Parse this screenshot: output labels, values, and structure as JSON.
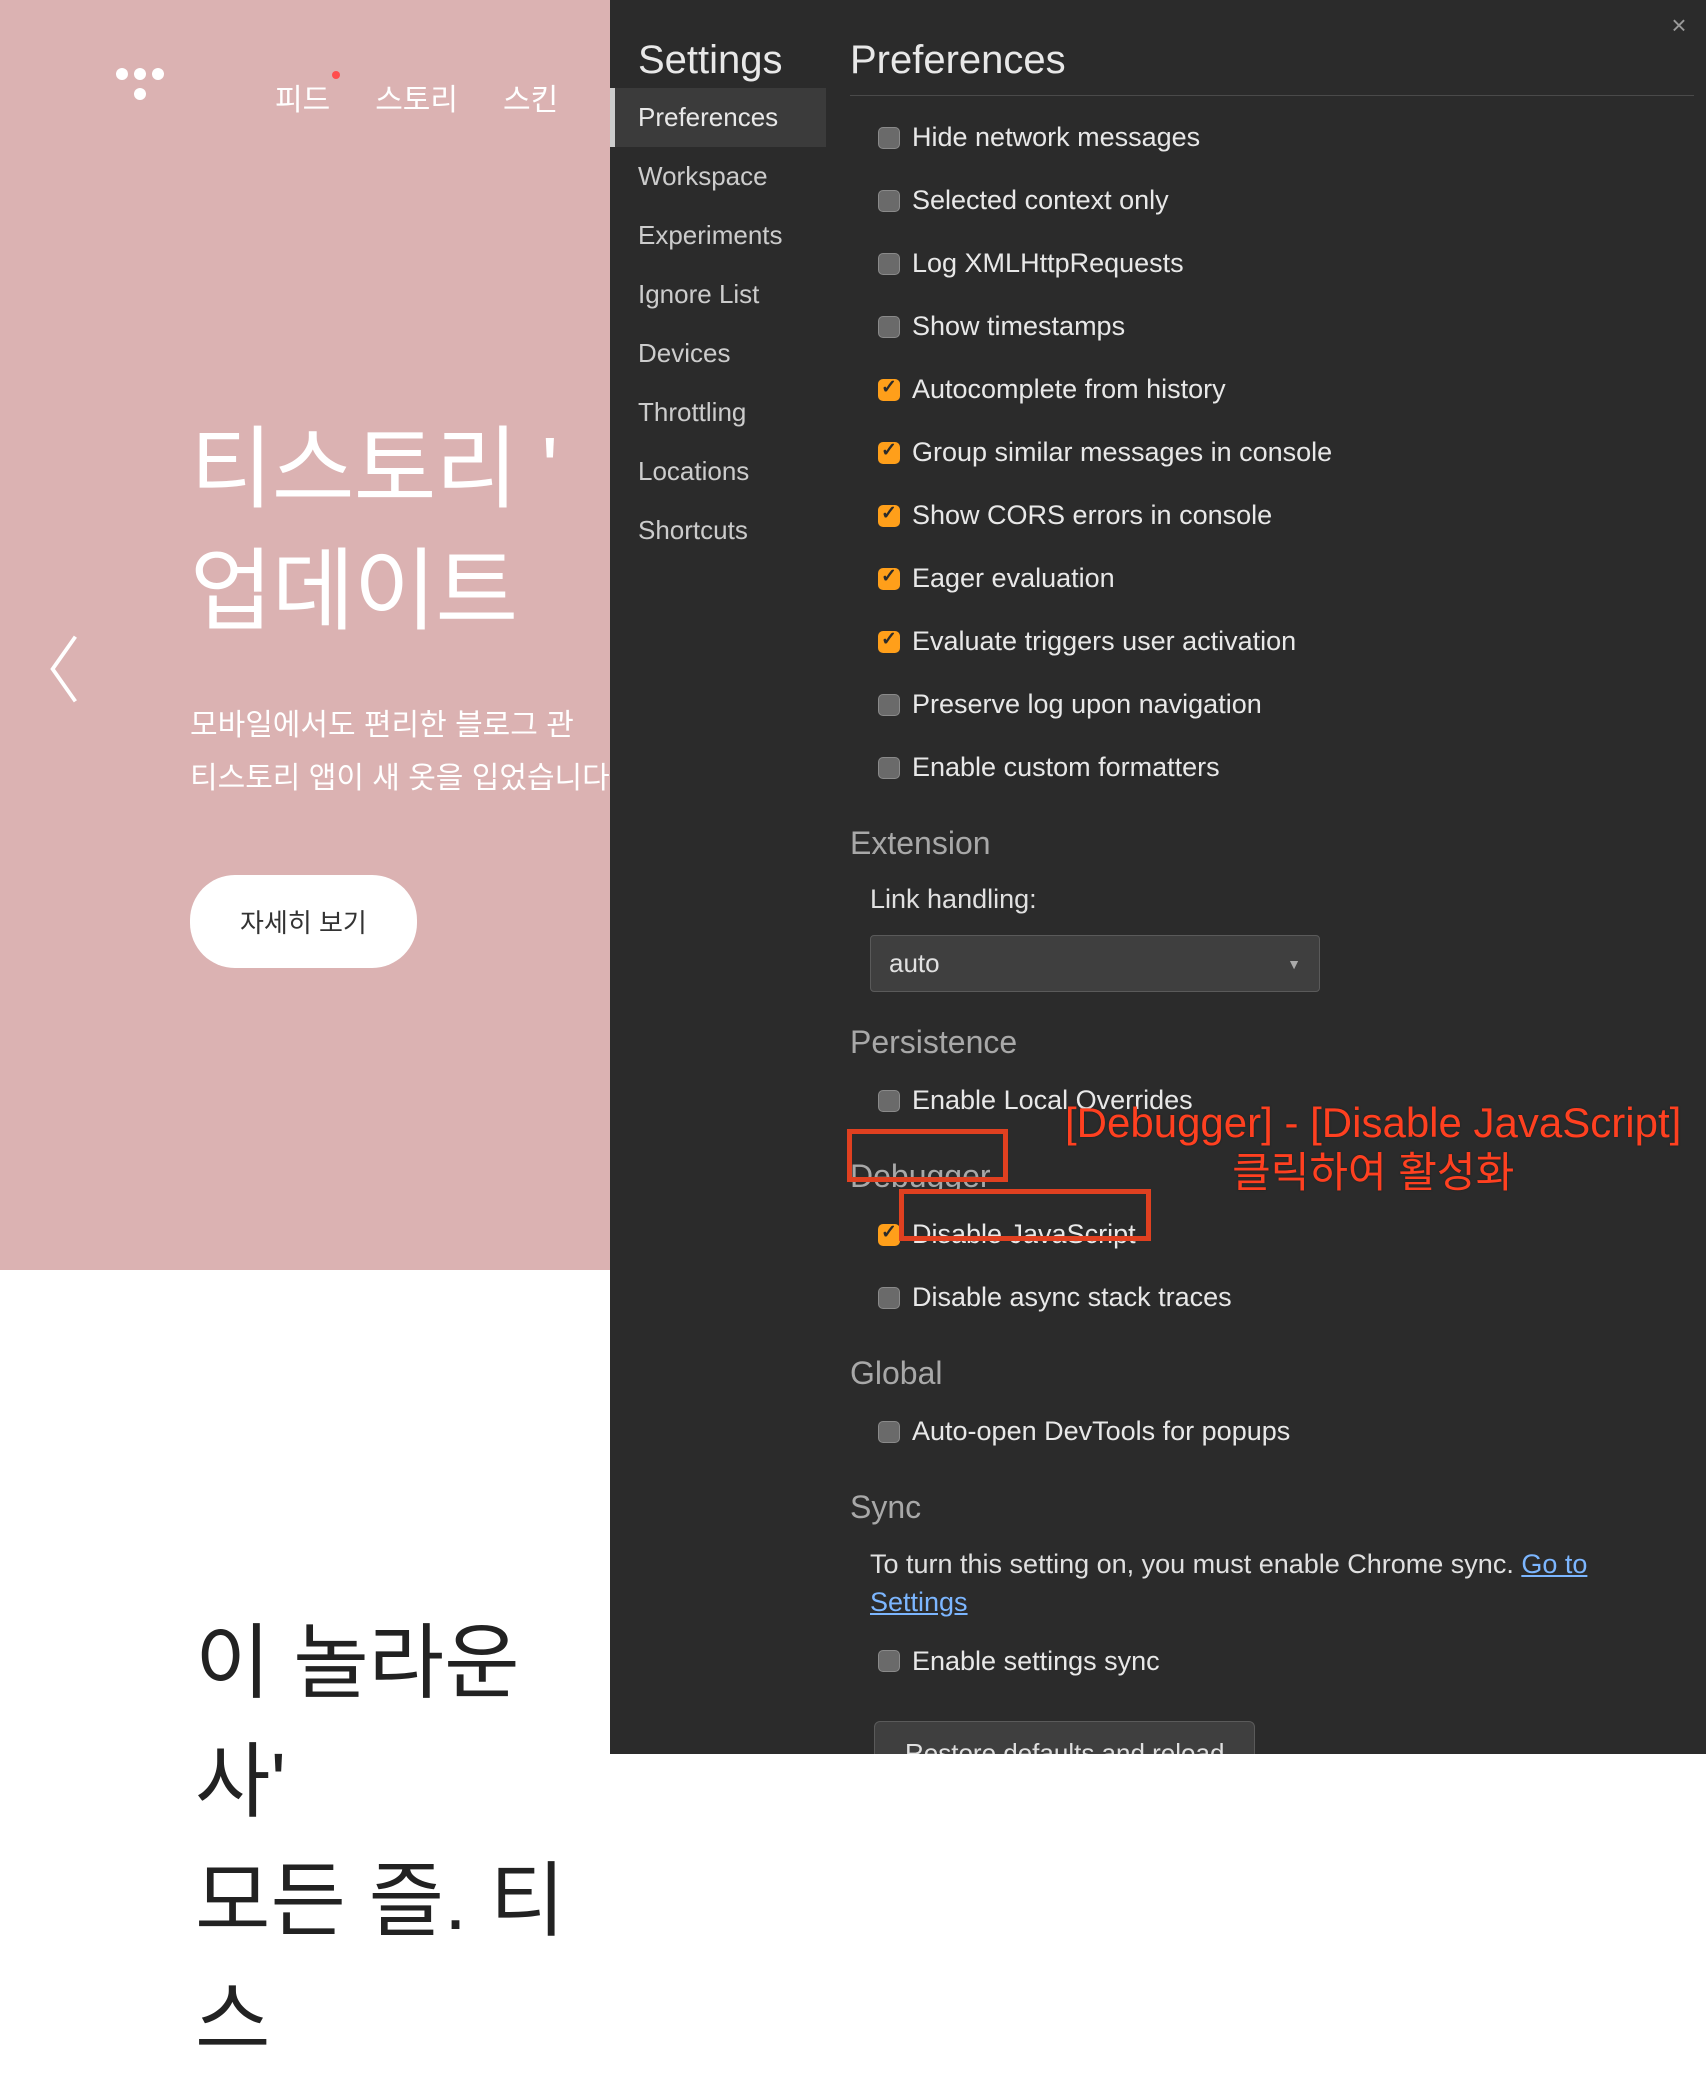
{
  "bg": {
    "nav": [
      "피드",
      "스토리",
      "스킨"
    ],
    "title_line1": "티스토리 '",
    "title_line2": "업데이트",
    "desc_line1": "모바일에서도 편리한 블로그 관",
    "desc_line2": "티스토리 앱이 새 옷을 입었습니다",
    "button": "자세히 보기",
    "bottom1": "이 놀라운 사'",
    "bottom2": "모든 즐. 티스"
  },
  "settings": {
    "title": "Settings",
    "close": "×",
    "sidebar": [
      "Preferences",
      "Workspace",
      "Experiments",
      "Ignore List",
      "Devices",
      "Throttling",
      "Locations",
      "Shortcuts"
    ],
    "preferences_title": "Preferences",
    "console": {
      "items": [
        {
          "label": "Hide network messages",
          "checked": false
        },
        {
          "label": "Selected context only",
          "checked": false
        },
        {
          "label": "Log XMLHttpRequests",
          "checked": false
        },
        {
          "label": "Show timestamps",
          "checked": false
        },
        {
          "label": "Autocomplete from history",
          "checked": true
        },
        {
          "label": "Group similar messages in console",
          "checked": true
        },
        {
          "label": "Show CORS errors in console",
          "checked": true
        },
        {
          "label": "Eager evaluation",
          "checked": true
        },
        {
          "label": "Evaluate triggers user activation",
          "checked": true
        },
        {
          "label": "Preserve log upon navigation",
          "checked": false
        },
        {
          "label": "Enable custom formatters",
          "checked": false
        }
      ]
    },
    "extension": {
      "title": "Extension",
      "link_handling": "Link handling:",
      "value": "auto"
    },
    "persistence": {
      "title": "Persistence",
      "items": [
        {
          "label": "Enable Local Overrides",
          "checked": false
        }
      ]
    },
    "debugger": {
      "title": "Debugger",
      "items": [
        {
          "label": "Disable JavaScript",
          "checked": true
        },
        {
          "label": "Disable async stack traces",
          "checked": false
        }
      ]
    },
    "global": {
      "title": "Global",
      "items": [
        {
          "label": "Auto-open DevTools for popups",
          "checked": false
        }
      ]
    },
    "sync": {
      "title": "Sync",
      "text": "To turn this setting on, you must enable Chrome sync. ",
      "link": "Go to Settings",
      "items": [
        {
          "label": "Enable settings sync",
          "checked": false
        }
      ]
    },
    "restore": "Restore defaults and reload"
  },
  "annotation": {
    "line1": "[Debugger] - [Disable JavaScript]",
    "line2": "클릭하여 활성화"
  }
}
